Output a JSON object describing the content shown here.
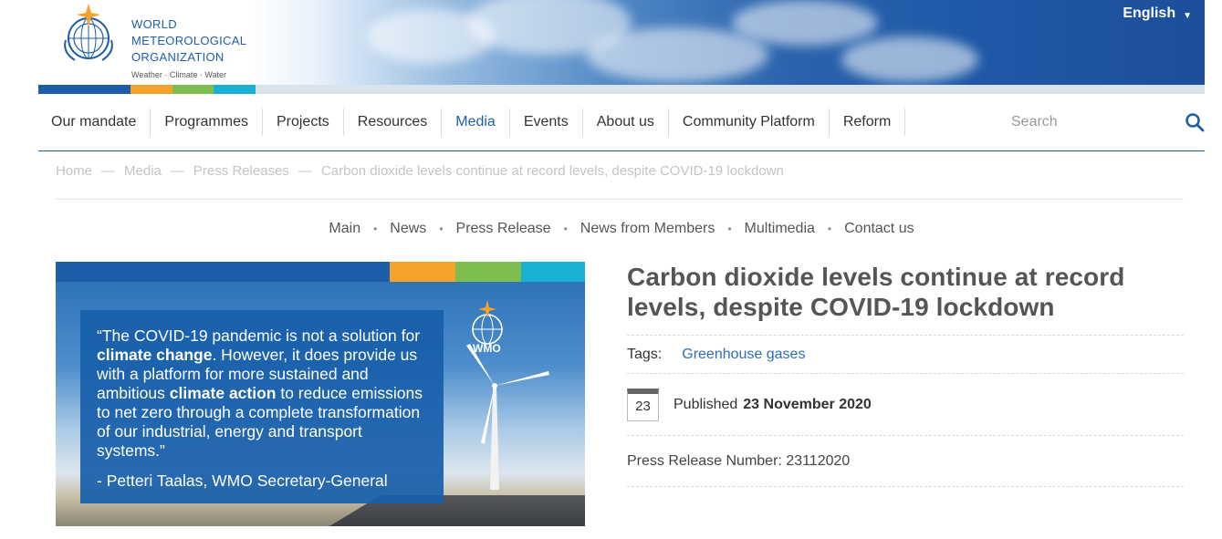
{
  "header": {
    "org_line1": "WORLD",
    "org_line2": "METEOROLOGICAL",
    "org_line3": "ORGANIZATION",
    "tagline": "Weather · Climate · Water",
    "language": "English",
    "colors": {
      "brand_blue": "#1e5ea8",
      "orange": "#f5a12a",
      "green": "#7ebd4f",
      "cyan": "#1ab0d3",
      "navy": "#1e5ea8"
    }
  },
  "nav": {
    "items": [
      {
        "label": "Our mandate"
      },
      {
        "label": "Programmes"
      },
      {
        "label": "Projects"
      },
      {
        "label": "Resources"
      },
      {
        "label": "Media"
      },
      {
        "label": "Events"
      },
      {
        "label": "About us"
      },
      {
        "label": "Community Platform"
      },
      {
        "label": "Reform"
      }
    ],
    "active": "Media",
    "search_placeholder": "Search"
  },
  "breadcrumb": {
    "items": [
      "Home",
      "Media",
      "Press Releases",
      "Carbon dioxide levels continue at record levels, despite COVID-19 lockdown"
    ],
    "separator": "—"
  },
  "subnav": {
    "items": [
      "Main",
      "News",
      "Press Release",
      "News from Members",
      "Multimedia",
      "Contact us"
    ]
  },
  "hero": {
    "quote_p1": "“The COVID-19 pandemic is not a solution for ",
    "quote_b1": "climate change",
    "quote_p2": ". However, it does provide us with a platform for more sustained and ambitious ",
    "quote_b2": "climate action",
    "quote_p3": " to reduce emissions to net zero through a complete transformation of our industrial, energy and transport systems.”",
    "author": "- Petteri Taalas, WMO Secretary-General",
    "logo_text": "WMO"
  },
  "article": {
    "title": "Carbon dioxide levels continue at record levels, despite COVID-19 lockdown",
    "tags_label": "Tags:",
    "tag": "Greenhouse gases",
    "day": "23",
    "published_label": "Published",
    "published_date": "23 November 2020",
    "press_release_number": "Press Release Number: 23112020"
  }
}
